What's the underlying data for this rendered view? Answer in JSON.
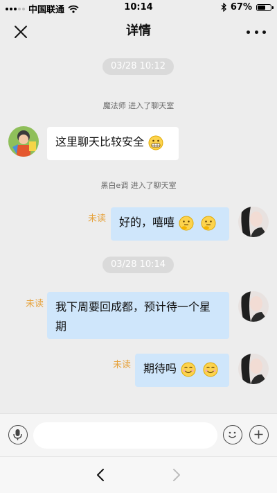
{
  "status_bar": {
    "carrier": "中国联通",
    "time": "10:14",
    "battery_text": "67%",
    "battery_level": 0.67
  },
  "nav": {
    "title": "详情"
  },
  "chat": {
    "timestamps": [
      "03/28 10:12",
      "03/28 10:14"
    ],
    "system_messages": [
      {
        "user": "魔法师",
        "action": "进入了聊天室"
      },
      {
        "user": "黑白e调",
        "action": "进入了聊天室"
      }
    ],
    "messages": [
      {
        "direction": "incoming",
        "text": "这里聊天比较安全",
        "emoji": [
          "grinning-face"
        ]
      },
      {
        "direction": "outgoing",
        "text": "好的，嘻嘻",
        "emoji": [
          "thinking-face",
          "thinking-face"
        ],
        "status": "未读"
      },
      {
        "direction": "outgoing",
        "text": "我下周要回成都，预计待一个星期",
        "emoji": [],
        "status": "未读"
      },
      {
        "direction": "outgoing",
        "text": "期待吗",
        "emoji": [
          "smiling-face",
          "smiling-face"
        ],
        "status": "未读"
      }
    ]
  },
  "composer": {
    "input_value": "",
    "icons": [
      "microphone-icon",
      "emoji-icon",
      "plus-icon"
    ]
  },
  "browser_bar": {
    "icons": [
      "back-chevron-icon",
      "forward-chevron-icon"
    ]
  },
  "colors": {
    "background": "#ededed",
    "outgoing_bubble": "#cfe6fb",
    "incoming_bubble": "#ffffff",
    "unread_label": "#e6a23c"
  }
}
